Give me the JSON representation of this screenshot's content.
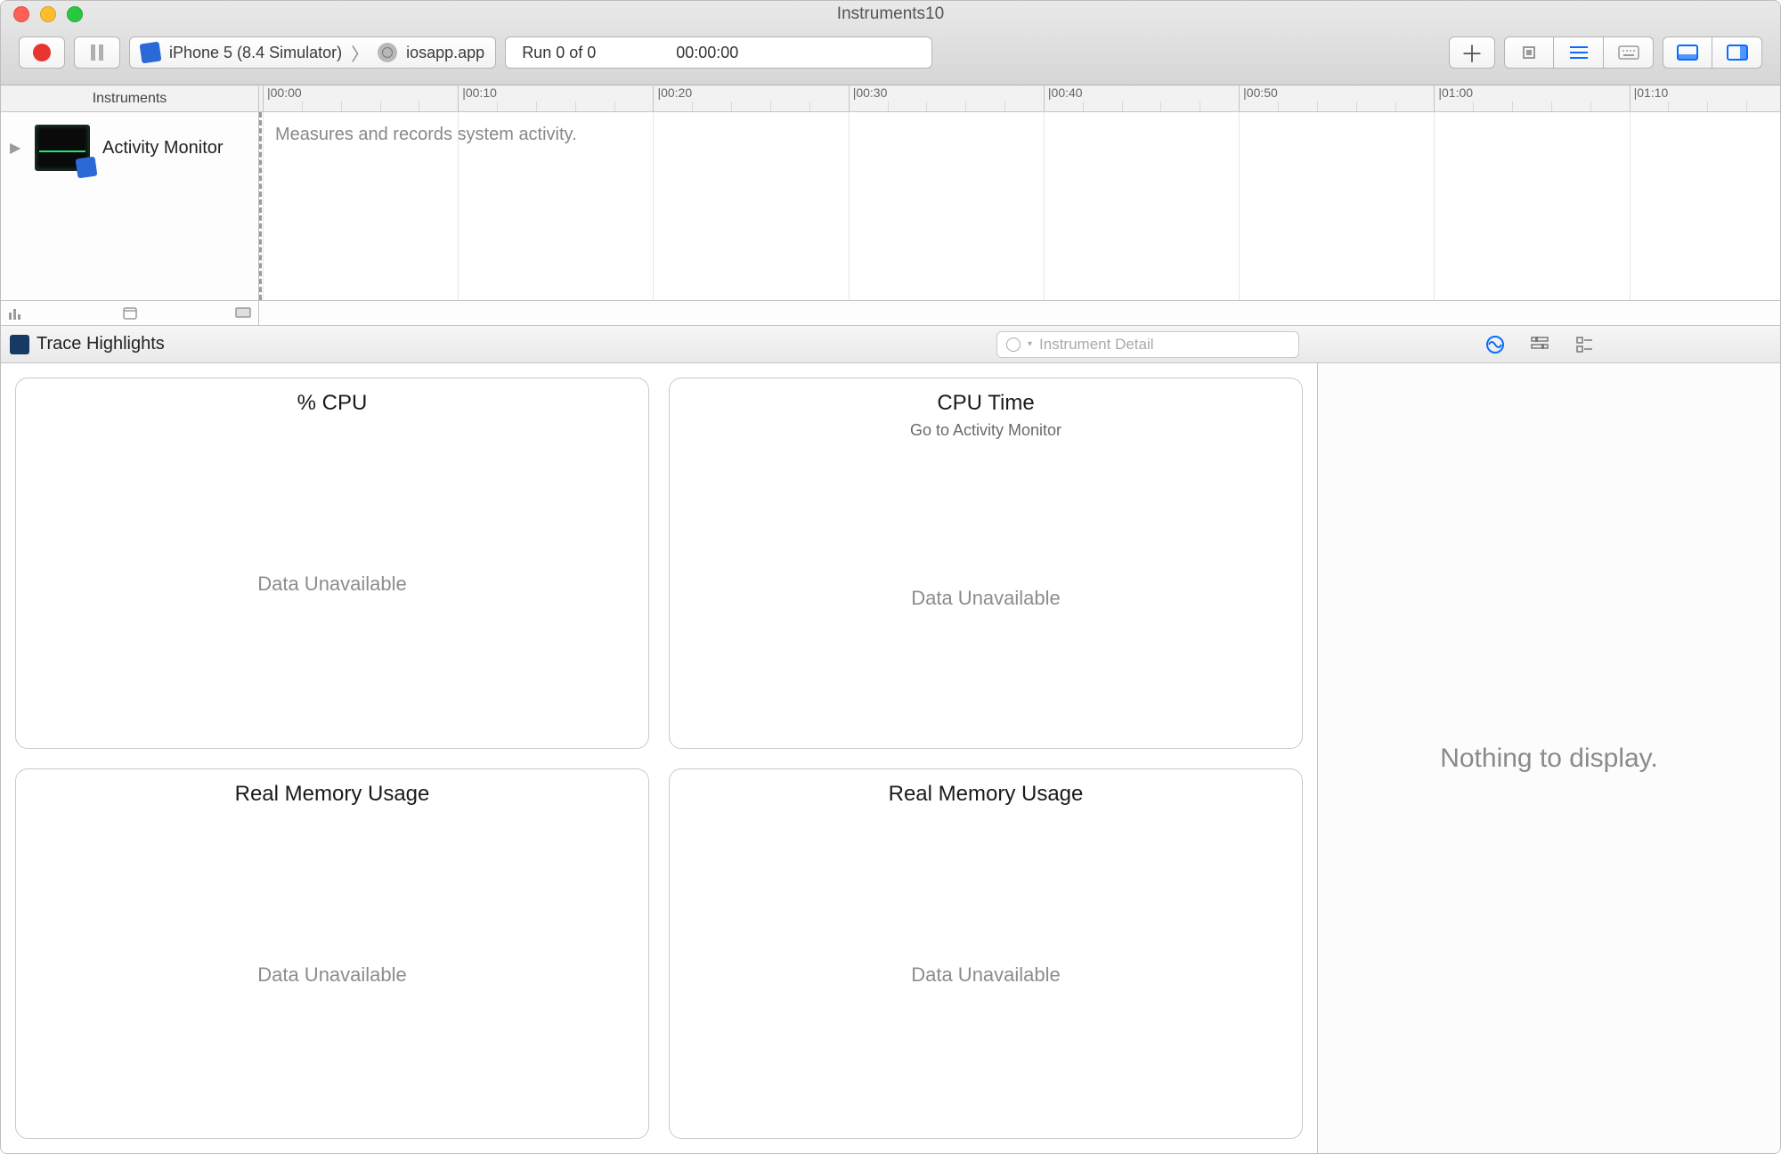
{
  "window": {
    "title": "Instruments10"
  },
  "toolbar": {
    "target_device": "iPhone 5 (8.4 Simulator)",
    "target_process": "iosapp.app",
    "run_label": "Run 0 of 0",
    "elapsed": "00:00:00"
  },
  "timeline": {
    "header_label": "Instruments",
    "ticks": [
      "00:00",
      "00:10",
      "00:20",
      "00:30",
      "00:40",
      "00:50",
      "01:00",
      "01:10"
    ],
    "tick_prefix": "|"
  },
  "track": {
    "name": "Activity Monitor",
    "description": "Measures and records system activity."
  },
  "detail": {
    "title": "Trace Highlights",
    "search_placeholder": "Instrument Detail"
  },
  "cards": [
    {
      "title": "% CPU",
      "subtitle": "",
      "body": "Data Unavailable"
    },
    {
      "title": "CPU Time",
      "subtitle": "Go to Activity Monitor",
      "body": "Data Unavailable"
    },
    {
      "title": "Real Memory Usage",
      "subtitle": "",
      "body": "Data Unavailable"
    },
    {
      "title": "Real Memory Usage",
      "subtitle": "",
      "body": "Data Unavailable"
    }
  ],
  "inspector": {
    "empty_message": "Nothing to display."
  }
}
